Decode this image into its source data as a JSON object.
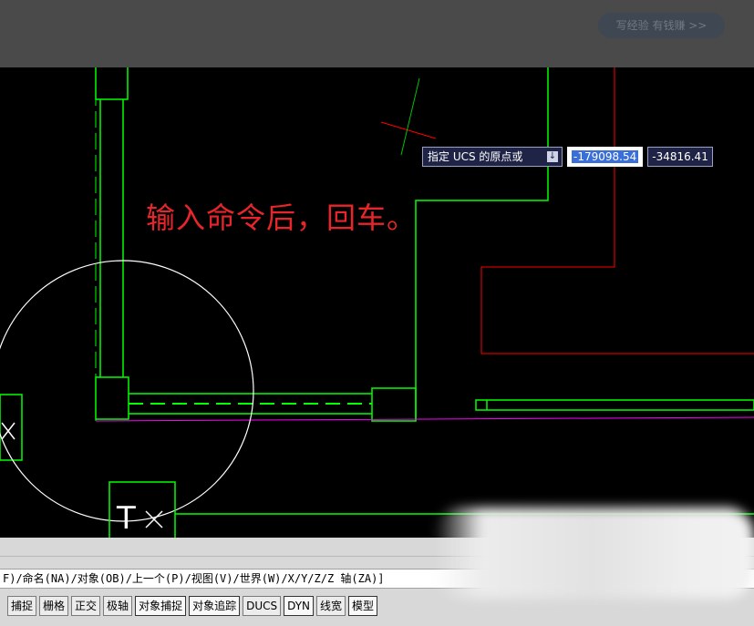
{
  "top_button": "写经验 有钱赚 >>",
  "annotation": "输入命令后，回车。",
  "dynamic_input": {
    "prompt": "指定 UCS 的原点或",
    "prompt_icon": "down-arrow-icon",
    "x_value": "-179098.54",
    "y_value": "-34816.41"
  },
  "command_line": "F)/命名(NA)/对象(OB)/上一个(P)/视图(V)/世界(W)/X/Y/Z/Z 轴(ZA)]",
  "status_buttons": [
    "捕捉",
    "栅格",
    "正交",
    "极轴",
    "对象捕捉",
    "对象追踪",
    "DUCS",
    "DYN",
    "线宽",
    "模型"
  ],
  "canvas_label": "T",
  "colors": {
    "green": "#00ff00",
    "red": "#ff0000",
    "magenta": "#ff00ff",
    "white": "#ffffff"
  }
}
